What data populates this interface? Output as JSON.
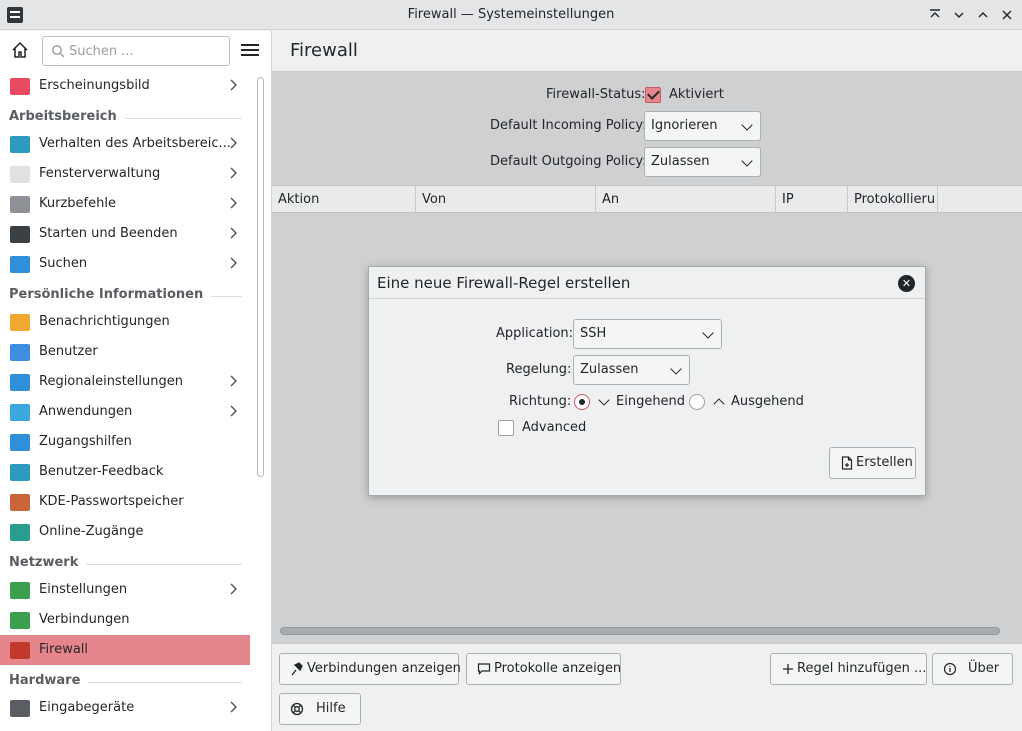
{
  "window": {
    "title": "Firewall — Systemeinstellungen",
    "controls": [
      "keep-above",
      "minimize",
      "maximize",
      "close"
    ]
  },
  "sidebar": {
    "search_placeholder": "Suchen ...",
    "entries": [
      {
        "kind": "item",
        "label": "Erscheinungsbild",
        "chevron": true,
        "icon": "appearance-icon",
        "color": "#e84a5f"
      },
      {
        "kind": "category",
        "label": "Arbeitsbereich"
      },
      {
        "kind": "item",
        "label": "Verhalten des Arbeitsbereic...",
        "chevron": true,
        "icon": "workspace-behavior-icon",
        "color": "#2d9cbc"
      },
      {
        "kind": "item",
        "label": "Fensterverwaltung",
        "chevron": true,
        "icon": "window-management-icon",
        "color": "#dfe1e3"
      },
      {
        "kind": "item",
        "label": "Kurzbefehle",
        "chevron": true,
        "icon": "keyboard-icon",
        "color": "#8d9196"
      },
      {
        "kind": "item",
        "label": "Starten und Beenden",
        "chevron": true,
        "icon": "monitor-icon",
        "color": "#3b4045"
      },
      {
        "kind": "item",
        "label": "Suchen",
        "chevron": true,
        "icon": "search-icon",
        "color": "#2f8fd8"
      },
      {
        "kind": "category",
        "label": "Persönliche Informationen"
      },
      {
        "kind": "item",
        "label": "Benachrichtigungen",
        "chevron": false,
        "icon": "bell-icon",
        "color": "#f0a830"
      },
      {
        "kind": "item",
        "label": "Benutzer",
        "chevron": false,
        "icon": "user-icon",
        "color": "#3d8ee0"
      },
      {
        "kind": "item",
        "label": "Regionaleinstellungen",
        "chevron": true,
        "icon": "region-icon",
        "color": "#2f8fd8"
      },
      {
        "kind": "item",
        "label": "Anwendungen",
        "chevron": true,
        "icon": "applications-icon",
        "color": "#3aa7e0"
      },
      {
        "kind": "item",
        "label": "Zugangshilfen",
        "chevron": false,
        "icon": "accessibility-icon",
        "color": "#2f8fd8"
      },
      {
        "kind": "item",
        "label": "Benutzer-Feedback",
        "chevron": false,
        "icon": "feedback-icon",
        "color": "#2d9cbc"
      },
      {
        "kind": "item",
        "label": "KDE-Passwortspeicher",
        "chevron": false,
        "icon": "wallet-icon",
        "color": "#c9643b"
      },
      {
        "kind": "item",
        "label": "Online-Zugänge",
        "chevron": false,
        "icon": "online-accounts-icon",
        "color": "#2a9d8f"
      },
      {
        "kind": "category",
        "label": "Netzwerk"
      },
      {
        "kind": "item",
        "label": "Einstellungen",
        "chevron": true,
        "icon": "globe-icon",
        "color": "#3a9e4f"
      },
      {
        "kind": "item",
        "label": "Verbindungen",
        "chevron": false,
        "icon": "globe-icon",
        "color": "#3a9e4f"
      },
      {
        "kind": "item",
        "label": "Firewall",
        "chevron": false,
        "icon": "firewall-icon",
        "color": "#c0392b",
        "active": true
      },
      {
        "kind": "category",
        "label": "Hardware"
      },
      {
        "kind": "item",
        "label": "Eingabegeräte",
        "chevron": true,
        "icon": "input-devices-icon",
        "color": "#5a5e62"
      }
    ]
  },
  "main": {
    "title": "Firewall",
    "status_label": "Firewall-Status:",
    "status_checked": true,
    "status_value": "Aktiviert",
    "incoming_label": "Default Incoming Policy:",
    "incoming_value": "Ignorieren",
    "outgoing_label": "Default Outgoing Policy:",
    "outgoing_value": "Zulassen",
    "columns": [
      "Aktion",
      "Von",
      "An",
      "IP",
      "Protokollieru"
    ],
    "buttons": {
      "connections": "Verbindungen anzeigen",
      "logs": "Protokolle anzeigen",
      "add_rule": "Regel hinzufügen ...",
      "about": "Über",
      "help": "Hilfe"
    }
  },
  "dialog": {
    "title": "Eine neue Firewall-Regel erstellen",
    "application_label": "Application:",
    "application_value": "SSH",
    "policy_label": "Regelung:",
    "policy_value": "Zulassen",
    "direction_label": "Richtung:",
    "direction_incoming": "Eingehend",
    "direction_outgoing": "Ausgehend",
    "direction_selected": "incoming",
    "advanced_label": "Advanced",
    "advanced_checked": false,
    "create_button": "Erstellen"
  },
  "colors": {
    "accent": "#e7858d",
    "accent_border": "#c45a63"
  }
}
